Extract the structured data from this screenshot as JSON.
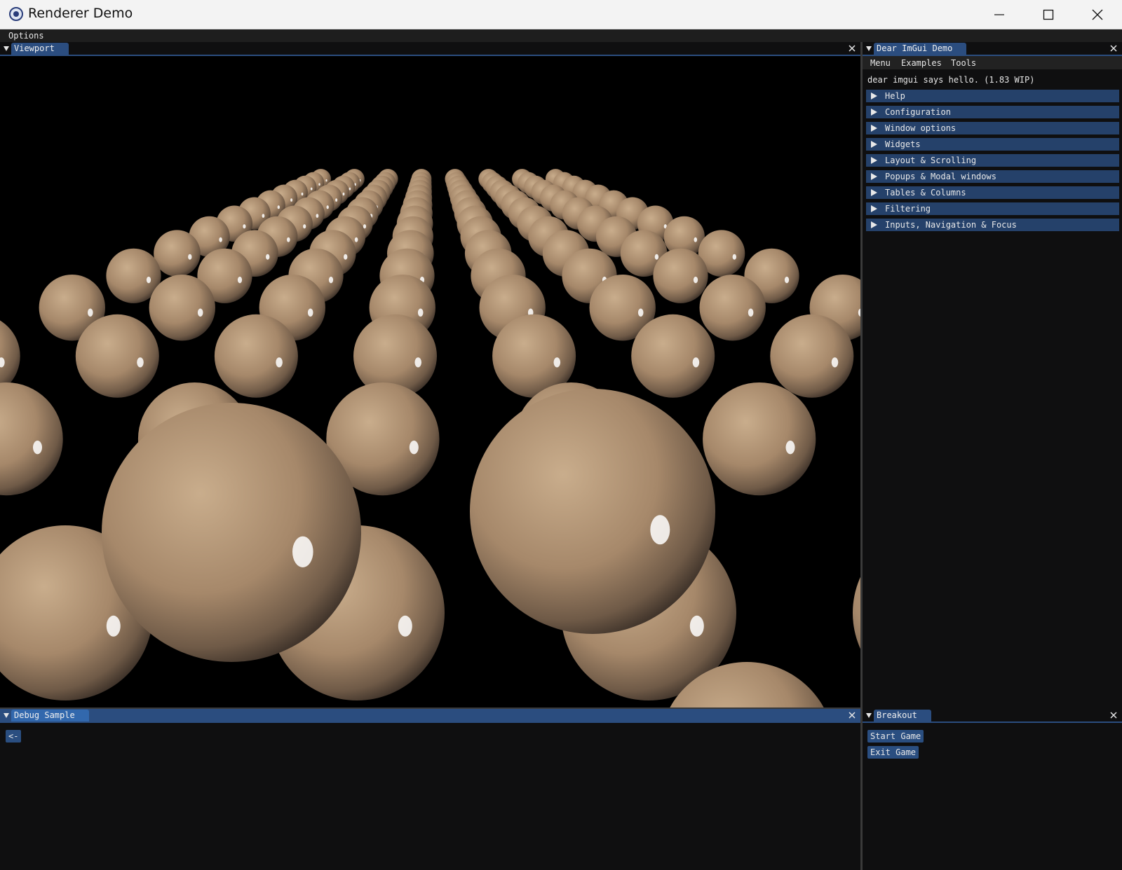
{
  "window": {
    "title": "Renderer Demo"
  },
  "menubar": {
    "options": "Options"
  },
  "viewport": {
    "tab_label": "Viewport"
  },
  "imgui_demo": {
    "tab_label": "Dear ImGui Demo",
    "menu": [
      "Menu",
      "Examples",
      "Tools"
    ],
    "hello": "dear imgui says hello. (1.83 WIP)",
    "headers": [
      "Help",
      "Configuration",
      "Window options",
      "Widgets",
      "Layout & Scrolling",
      "Popups & Modal windows",
      "Tables & Columns",
      "Filtering",
      "Inputs, Navigation & Focus"
    ]
  },
  "debug": {
    "tab_label": "Debug Sample",
    "back_button": "<-"
  },
  "breakout": {
    "tab_label": "Breakout",
    "start_button": "Start Game",
    "exit_button": "Exit Game"
  },
  "colors": {
    "accent": "#2b4d7f",
    "tab_active": "#3268ad",
    "header": "#25416a",
    "planet": "#a98b6a"
  },
  "icons": {
    "app": "renderer-app-icon",
    "minimize": "minimize-icon",
    "maximize": "maximize-icon",
    "close": "close-icon"
  }
}
